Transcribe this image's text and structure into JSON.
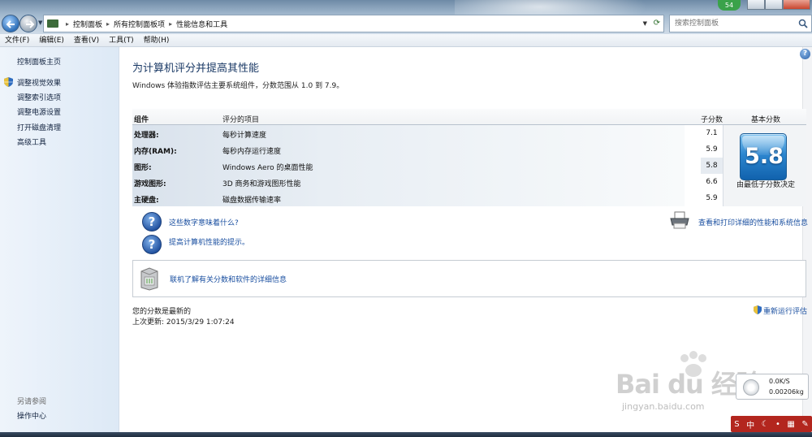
{
  "window": {
    "breadcrumbs": [
      "控制面板",
      "所有控制面板项",
      "性能信息和工具"
    ],
    "search_placeholder": "搜索控制面板",
    "badge": "54"
  },
  "menu": [
    {
      "label": "文件(F)"
    },
    {
      "label": "编辑(E)"
    },
    {
      "label": "查看(V)"
    },
    {
      "label": "工具(T)"
    },
    {
      "label": "帮助(H)"
    }
  ],
  "sidebar": {
    "home": "控制面板主页",
    "links": [
      "调整视觉效果",
      "调整索引选项",
      "调整电源设置",
      "打开磁盘清理",
      "高级工具"
    ],
    "see_also": "另请参阅",
    "action_center": "操作中心"
  },
  "main": {
    "help": "?",
    "title": "为计算机评分并提高其性能",
    "description": "Windows 体验指数评估主要系统组件，分数范围从 1.0 到 7.9。",
    "table": {
      "headers": {
        "component": "组件",
        "rated": "评分的项目",
        "subscore": "子分数",
        "base": "基本分数"
      },
      "rows": [
        {
          "component": "处理器:",
          "item": "每秒计算速度",
          "subscore": "7.1"
        },
        {
          "component": "内存(RAM):",
          "item": "每秒内存运行速度",
          "subscore": "5.9"
        },
        {
          "component": "图形:",
          "item": "Windows Aero 的桌面性能",
          "subscore": "5.8"
        },
        {
          "component": "游戏图形:",
          "item": "3D 商务和游戏图形性能",
          "subscore": "6.6"
        },
        {
          "component": "主硬盘:",
          "item": "磁盘数据传输速率",
          "subscore": "5.9"
        }
      ],
      "base_score": "5.8",
      "base_note": "由最低子分数决定"
    },
    "link_meaning": "这些数字意味着什么?",
    "link_tips": "提高计算机性能的提示。",
    "link_print": "查看和打印详细的性能和系统信息",
    "link_online": "联机了解有关分数和软件的详细信息",
    "status_current": "您的分数是最新的",
    "status_updated": "上次更新: 2015/3/29 1:07:24",
    "rerun": "重新运行评估"
  },
  "overlay": {
    "net_speed": "0.0K/S",
    "mem": "0.00206kg",
    "watermark_logo": "Bai du 经验",
    "watermark_url": "jingyan.baidu.com",
    "ime_label": "中"
  }
}
